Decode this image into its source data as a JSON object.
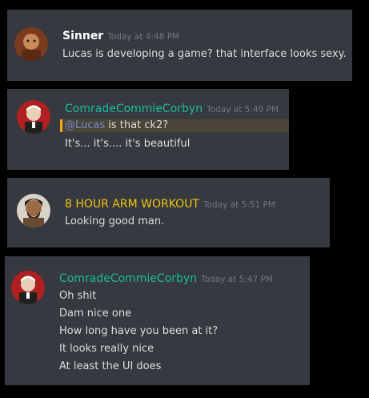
{
  "messages": [
    {
      "username": "Sinner",
      "username_color": "#ffffff",
      "timestamp": "Today at 4:48 PM",
      "avatar_icon": "user-avatar-icon",
      "lines": [
        "Lucas is developing a game? that interface looks sexy."
      ]
    },
    {
      "username": "ComradeCommieCorbyn",
      "username_color": "#1abc9c",
      "timestamp": "Today at 5:40 PM",
      "avatar_icon": "user-avatar-icon",
      "mention": "@Lucas",
      "mention_rest": " is that ck2?",
      "lines": [
        "It's... it's.... it's beautiful"
      ]
    },
    {
      "username": "8 HOUR ARM WORKOUT",
      "username_color": "#f1c40f",
      "timestamp": "Today at 5:51 PM",
      "avatar_icon": "user-avatar-icon",
      "lines": [
        "Looking good man."
      ]
    },
    {
      "username": "ComradeCommieCorbyn",
      "username_color": "#1abc9c",
      "timestamp": "Today at 5:47 PM",
      "avatar_icon": "user-avatar-icon",
      "lines": [
        "Oh shit",
        "Dam nice one",
        "How long have you been at it?",
        "It looks really nice",
        "At least the UI does"
      ]
    }
  ]
}
